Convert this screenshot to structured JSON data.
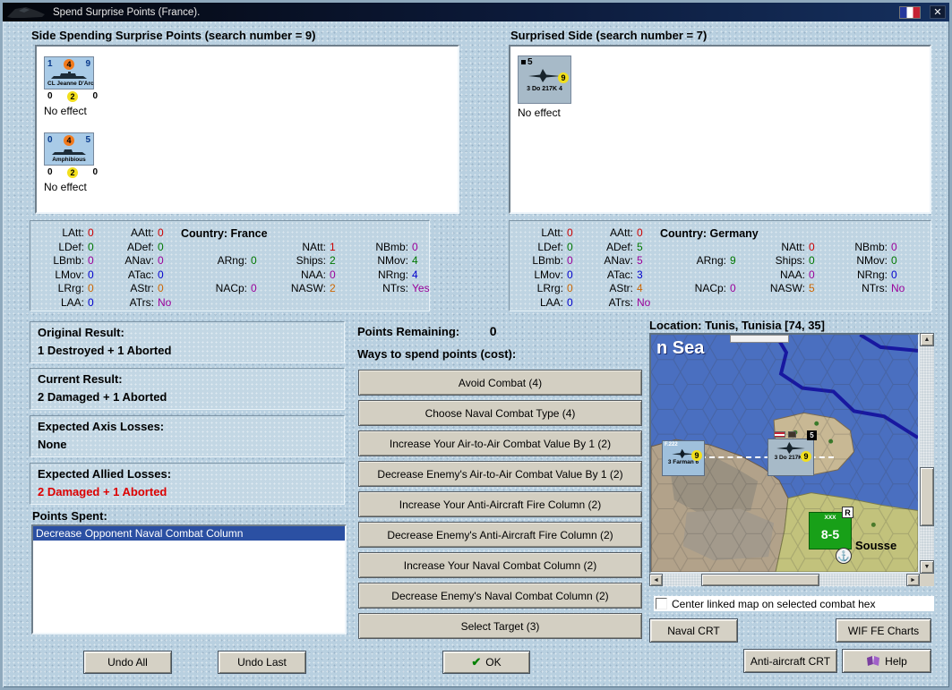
{
  "titlebar": {
    "title": "Spend Surprise Points (France).",
    "close": "✕"
  },
  "spender_panel": {
    "title": "Side Spending Surprise Points (search number = 9)",
    "units": [
      {
        "top_left": "1",
        "top_mid": "4",
        "top_right": "9",
        "name": "CL Jeanne D'Arc",
        "bot_left": "0",
        "bot_mid": "2",
        "bot_right": "0",
        "effect": "No effect"
      },
      {
        "top_left": "0",
        "top_mid": "4",
        "top_right": "5",
        "name": "Amphibious",
        "bot_left": "0",
        "bot_mid": "2",
        "bot_right": "0",
        "effect": "No effect"
      }
    ]
  },
  "surprised_panel": {
    "title": "Surprised Side (search number = 7)",
    "unit": {
      "badge": "5",
      "range": "9",
      "name": "3 Do 217K 4",
      "effect": "No effect"
    }
  },
  "stats_france": {
    "country": "Country: France",
    "cells": [
      {
        "col": 1,
        "row": 1,
        "label": "LAtt:",
        "value": "0",
        "color": "red"
      },
      {
        "col": 1,
        "row": 2,
        "label": "LDef:",
        "value": "0",
        "color": "green"
      },
      {
        "col": 1,
        "row": 3,
        "label": "LBmb:",
        "value": "0",
        "color": "purple"
      },
      {
        "col": 1,
        "row": 4,
        "label": "LMov:",
        "value": "0",
        "color": "blue"
      },
      {
        "col": 1,
        "row": 5,
        "label": "LRrg:",
        "value": "0",
        "color": "orange"
      },
      {
        "col": 1,
        "row": 6,
        "label": "LAA:",
        "value": "0",
        "color": "blue"
      },
      {
        "col": 2,
        "row": 1,
        "label": "AAtt:",
        "value": "0",
        "color": "red"
      },
      {
        "col": 2,
        "row": 2,
        "label": "ADef:",
        "value": "0",
        "color": "green"
      },
      {
        "col": 2,
        "row": 3,
        "label": "ANav:",
        "value": "0",
        "color": "purple"
      },
      {
        "col": 2,
        "row": 4,
        "label": "ATac:",
        "value": "0",
        "color": "blue"
      },
      {
        "col": 2,
        "row": 5,
        "label": "AStr:",
        "value": "0",
        "color": "orange"
      },
      {
        "col": 2,
        "row": 6,
        "label": "ATrs:",
        "value": "No",
        "color": "purple"
      },
      {
        "col": 3,
        "row": 3,
        "label": "ARng:",
        "value": "0",
        "color": "green"
      },
      {
        "col": 3,
        "row": 5,
        "label": "NACp:",
        "value": "0",
        "color": "purple"
      },
      {
        "col": 4,
        "row": 2,
        "label": "NAtt:",
        "value": "1",
        "color": "red"
      },
      {
        "col": 4,
        "row": 3,
        "label": "Ships:",
        "value": "2",
        "color": "green"
      },
      {
        "col": 4,
        "row": 4,
        "label": "NAA:",
        "value": "0",
        "color": "purple"
      },
      {
        "col": 4,
        "row": 5,
        "label": "NASW:",
        "value": "2",
        "color": "orange"
      },
      {
        "col": 5,
        "row": 2,
        "label": "NBmb:",
        "value": "0",
        "color": "purple"
      },
      {
        "col": 5,
        "row": 3,
        "label": "NMov:",
        "value": "4",
        "color": "green"
      },
      {
        "col": 5,
        "row": 4,
        "label": "NRng:",
        "value": "4",
        "color": "blue"
      },
      {
        "col": 5,
        "row": 5,
        "label": "NTrs:",
        "value": "Yes",
        "color": "purple"
      }
    ]
  },
  "stats_germany": {
    "country": "Country: Germany",
    "cells": [
      {
        "col": 1,
        "row": 1,
        "label": "LAtt:",
        "value": "0",
        "color": "red"
      },
      {
        "col": 1,
        "row": 2,
        "label": "LDef:",
        "value": "0",
        "color": "green"
      },
      {
        "col": 1,
        "row": 3,
        "label": "LBmb:",
        "value": "0",
        "color": "purple"
      },
      {
        "col": 1,
        "row": 4,
        "label": "LMov:",
        "value": "0",
        "color": "blue"
      },
      {
        "col": 1,
        "row": 5,
        "label": "LRrg:",
        "value": "0",
        "color": "orange"
      },
      {
        "col": 1,
        "row": 6,
        "label": "LAA:",
        "value": "0",
        "color": "blue"
      },
      {
        "col": 2,
        "row": 1,
        "label": "AAtt:",
        "value": "0",
        "color": "red"
      },
      {
        "col": 2,
        "row": 2,
        "label": "ADef:",
        "value": "5",
        "color": "green"
      },
      {
        "col": 2,
        "row": 3,
        "label": "ANav:",
        "value": "5",
        "color": "purple"
      },
      {
        "col": 2,
        "row": 4,
        "label": "ATac:",
        "value": "3",
        "color": "blue"
      },
      {
        "col": 2,
        "row": 5,
        "label": "AStr:",
        "value": "4",
        "color": "orange"
      },
      {
        "col": 2,
        "row": 6,
        "label": "ATrs:",
        "value": "No",
        "color": "purple"
      },
      {
        "col": 3,
        "row": 3,
        "label": "ARng:",
        "value": "9",
        "color": "green"
      },
      {
        "col": 3,
        "row": 5,
        "label": "NACp:",
        "value": "0",
        "color": "purple"
      },
      {
        "col": 4,
        "row": 2,
        "label": "NAtt:",
        "value": "0",
        "color": "red"
      },
      {
        "col": 4,
        "row": 3,
        "label": "Ships:",
        "value": "0",
        "color": "green"
      },
      {
        "col": 4,
        "row": 4,
        "label": "NAA:",
        "value": "0",
        "color": "purple"
      },
      {
        "col": 4,
        "row": 5,
        "label": "NASW:",
        "value": "5",
        "color": "orange"
      },
      {
        "col": 5,
        "row": 2,
        "label": "NBmb:",
        "value": "0",
        "color": "purple"
      },
      {
        "col": 5,
        "row": 3,
        "label": "NMov:",
        "value": "0",
        "color": "green"
      },
      {
        "col": 5,
        "row": 4,
        "label": "NRng:",
        "value": "0",
        "color": "blue"
      },
      {
        "col": 5,
        "row": 5,
        "label": "NTrs:",
        "value": "No",
        "color": "purple"
      }
    ]
  },
  "results": {
    "original_label": "Original Result:",
    "original_value": "1 Destroyed + 1 Aborted",
    "current_label": "Current Result:",
    "current_value": "2 Damaged + 1 Aborted",
    "axis_label": "Expected Axis Losses:",
    "axis_value": "None",
    "allied_label": "Expected Allied Losses:",
    "allied_value": "2 Damaged + 1 Aborted"
  },
  "points_spent": {
    "label": "Points Spent:",
    "items": [
      "Decrease Opponent Naval Combat Column"
    ]
  },
  "ways": {
    "points_remaining_label": "Points Remaining:",
    "points_remaining_value": "0",
    "heading": "Ways to spend points (cost):",
    "items": [
      "Avoid Combat (4)",
      "Choose Naval Combat Type (4)",
      "Increase Your Air-to-Air Combat Value By 1 (2)",
      "Decrease Enemy's Air-to-Air Combat Value By 1 (2)",
      "Increase Your Anti-Aircraft Fire Column (2)",
      "Decrease Enemy's Anti-Aircraft Fire Column (2)",
      "Increase Your Naval Combat Column (2)",
      "Decrease Enemy's Naval Combat Column (2)",
      "Select Target (3)"
    ]
  },
  "buttons": {
    "undo_all": "Undo All",
    "undo_last": "Undo Last",
    "ok": "OK",
    "naval_crt": "Naval CRT",
    "wif_fe_charts": "WIF FE Charts",
    "anti_aircraft_crt": "Anti-aircraft CRT",
    "help": "Help"
  },
  "map": {
    "location": "Location: Tunis, Tunisia [74, 35]",
    "sea_label": "n Sea",
    "town": "Sousse",
    "checkbox_label": "Center linked map on selected combat hex",
    "farman": {
      "model": "F.222",
      "name": "3 Farman 6",
      "range": "9"
    },
    "do217": {
      "name": "3 Do 217K 4",
      "range": "9",
      "badge": "5"
    },
    "green_unit": {
      "echelon": "XXX",
      "strength": "8-5",
      "badge": "R"
    }
  },
  "colors": {
    "value_red": "#cc0000",
    "value_green": "#007700",
    "value_purple": "#990099",
    "value_blue": "#0000cc",
    "value_orange": "#cc6600",
    "selection_bg": "#2b50a3",
    "sea": "#4a6fc0",
    "land_rock": "#b2a28a",
    "land_plain": "#c2c27c"
  }
}
